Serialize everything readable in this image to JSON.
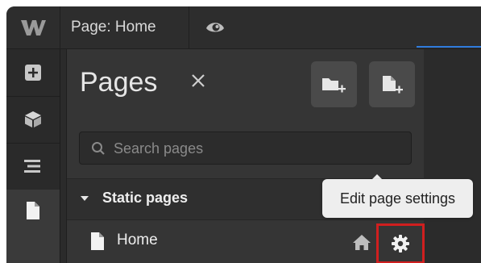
{
  "topbar": {
    "logo": "W",
    "page_title": "Page: Home",
    "preview_icon": "eye-icon"
  },
  "rail": {
    "items": [
      {
        "icon": "plus-square-icon"
      },
      {
        "icon": "cube-icon"
      },
      {
        "icon": "navigator-icon"
      },
      {
        "icon": "page-icon"
      }
    ]
  },
  "panel": {
    "title": "Pages",
    "close_icon": "close-icon",
    "add_folder_icon": "add-folder-icon",
    "add_page_icon": "add-page-icon",
    "search": {
      "placeholder": "Search pages",
      "value": ""
    },
    "section": {
      "label": "Static pages"
    },
    "pages": [
      {
        "label": "Home",
        "is_home": true
      }
    ]
  },
  "tooltip": {
    "text": "Edit page settings"
  },
  "colors": {
    "highlight": "#d01f1f",
    "accent": "#2f7bdc",
    "panel_bg": "#353535"
  }
}
